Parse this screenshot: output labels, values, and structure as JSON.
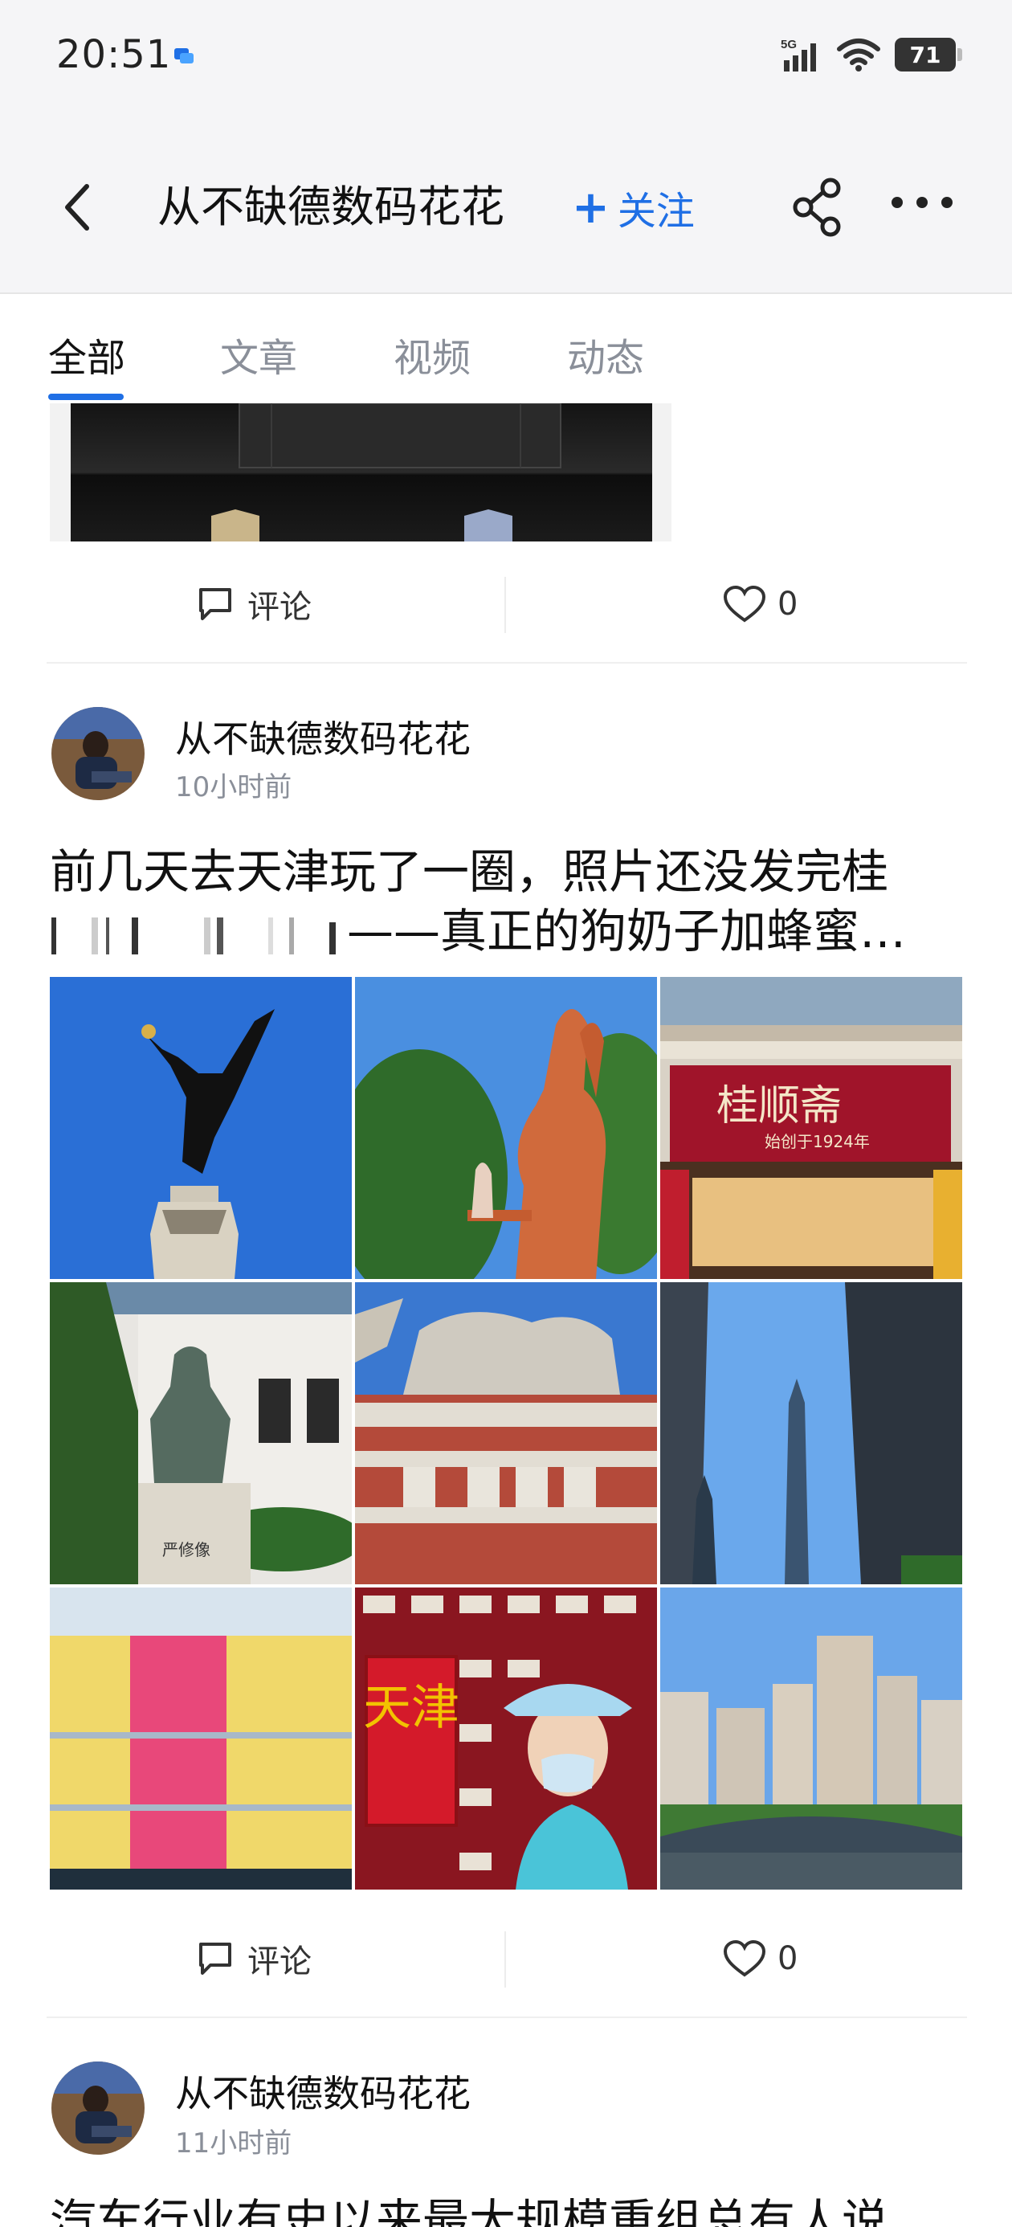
{
  "status_bar": {
    "time": "20:51",
    "network": "5G",
    "battery": "71",
    "icons": [
      "chat-app-icon",
      "signal-icon",
      "wifi-icon",
      "battery-icon"
    ]
  },
  "header": {
    "title": "从不缺德数码花花",
    "follow_plus": "+",
    "follow_label": "关注",
    "icons": [
      "back-arrow-icon",
      "share-icon",
      "more-icon"
    ],
    "accent_color": "#1f6fe5"
  },
  "tabs": [
    {
      "label": "全部",
      "active": true
    },
    {
      "label": "文章",
      "active": false
    },
    {
      "label": "视频",
      "active": false
    },
    {
      "label": "动态",
      "active": false
    }
  ],
  "posts": [
    {
      "comment_label": "评论",
      "like_count": "0"
    },
    {
      "author": "从不缺德数码花花",
      "time": "10小时前",
      "text_line1": "前几天去天津玩了一圈，照片还没发完桂",
      "text_line2": "——真正的狗奶子加蜂蜜…",
      "images": [
        {
          "name": "angel-statue-photo"
        },
        {
          "name": "rabbit-sculpture-photo"
        },
        {
          "name": "guishunzhai-shop-photo",
          "sign": "桂顺斋",
          "sub": "始创于1924年"
        },
        {
          "name": "bronze-statue-photo",
          "plaque": "严修像"
        },
        {
          "name": "porcelain-house-photo"
        },
        {
          "name": "skyscrapers-photo"
        },
        {
          "name": "snack-packages-photo"
        },
        {
          "name": "tianjin-sign-selfie-photo",
          "sign": "天津"
        },
        {
          "name": "riverside-skyline-photo"
        }
      ],
      "comment_label": "评论",
      "like_count": "0"
    },
    {
      "author": "从不缺德数码花花",
      "time": "11小时前",
      "text_line1": "汽车行业有史以来最大规模重组总有人说"
    }
  ]
}
